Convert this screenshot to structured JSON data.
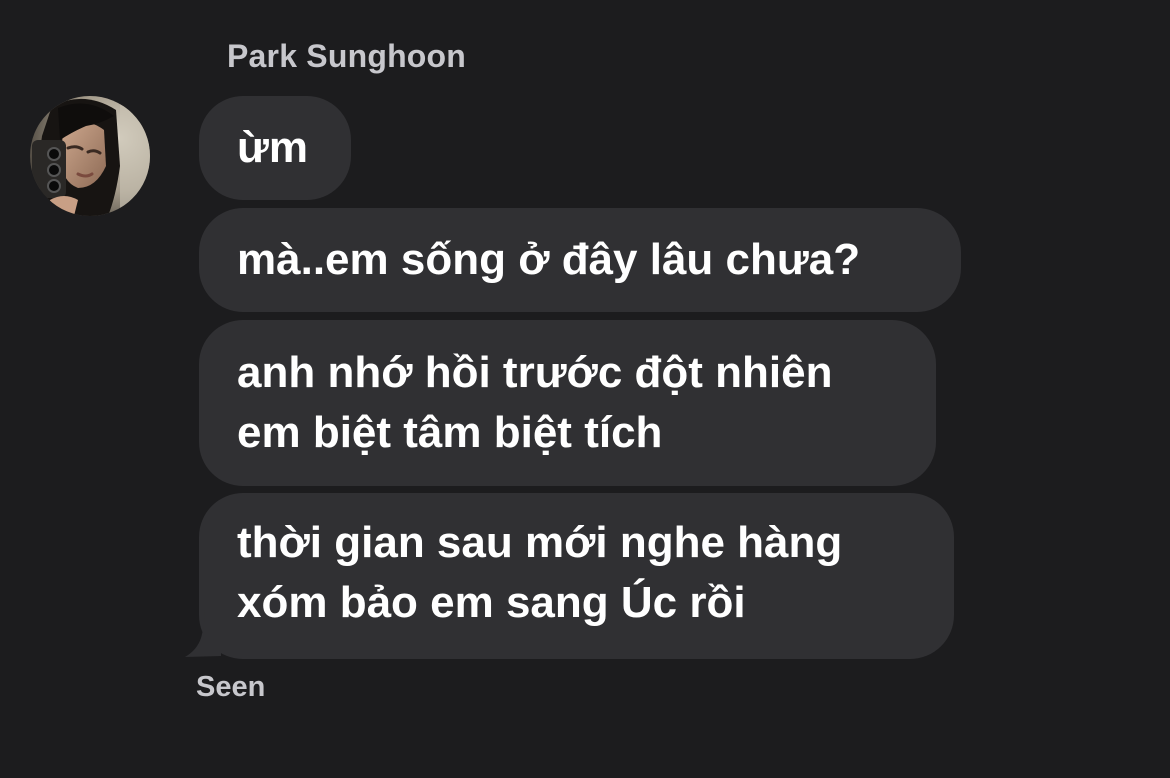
{
  "conversation": {
    "sender_name": "Park Sunghoon",
    "messages": [
      {
        "lines": [
          "ừm"
        ]
      },
      {
        "lines": [
          "mà..em sống ở đây lâu chưa?"
        ]
      },
      {
        "lines": [
          "anh nhớ hồi trước đột nhiên",
          "em biệt tâm biệt tích"
        ]
      },
      {
        "lines": [
          "thời gian sau mới nghe hàng",
          "xóm bảo em sang Úc rồi"
        ]
      }
    ],
    "status": "Seen"
  },
  "colors": {
    "background": "#1c1c1e",
    "bubble": "#303033",
    "message_text": "#ffffff",
    "secondary_text": "#c7c7cc"
  }
}
